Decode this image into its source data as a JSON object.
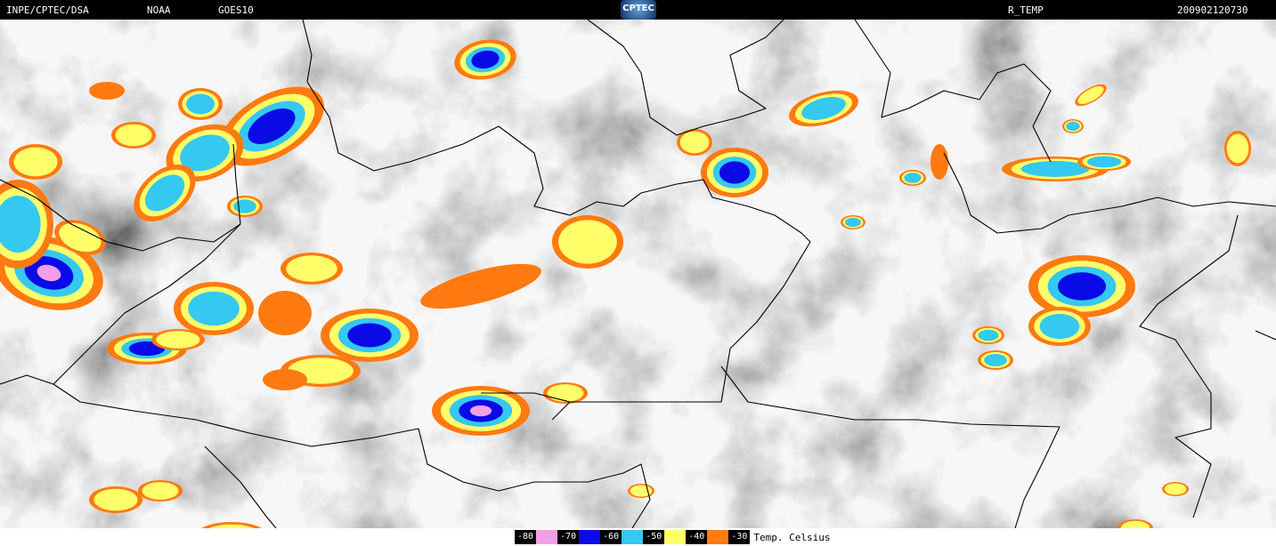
{
  "header": {
    "left": "INPE/CPTEC/DSA",
    "agency": "NOAA",
    "satellite": "GOES10",
    "logo": "CPTEC",
    "product": "R_TEMP",
    "timestamp": "200902120730"
  },
  "legend": {
    "items": [
      {
        "label": "-80",
        "color": "#f59ee8"
      },
      {
        "label": "-70",
        "color": "#0a0ae6"
      },
      {
        "label": "-60",
        "color": "#35c8f0"
      },
      {
        "label": "-50",
        "color": "#ffff6a"
      },
      {
        "label": "-40",
        "color": "#ff7a10"
      },
      {
        "label": "-30",
        "color": "#ff7a10"
      }
    ],
    "unit": "Temp. Celsius"
  },
  "colors": {
    "background": "#000000",
    "footer": "#ffffff",
    "orange": "#ff7a10",
    "yellow": "#ffff6a",
    "cyan": "#35c8f0",
    "blue": "#0a0ae6",
    "pink": "#f59ee8"
  }
}
